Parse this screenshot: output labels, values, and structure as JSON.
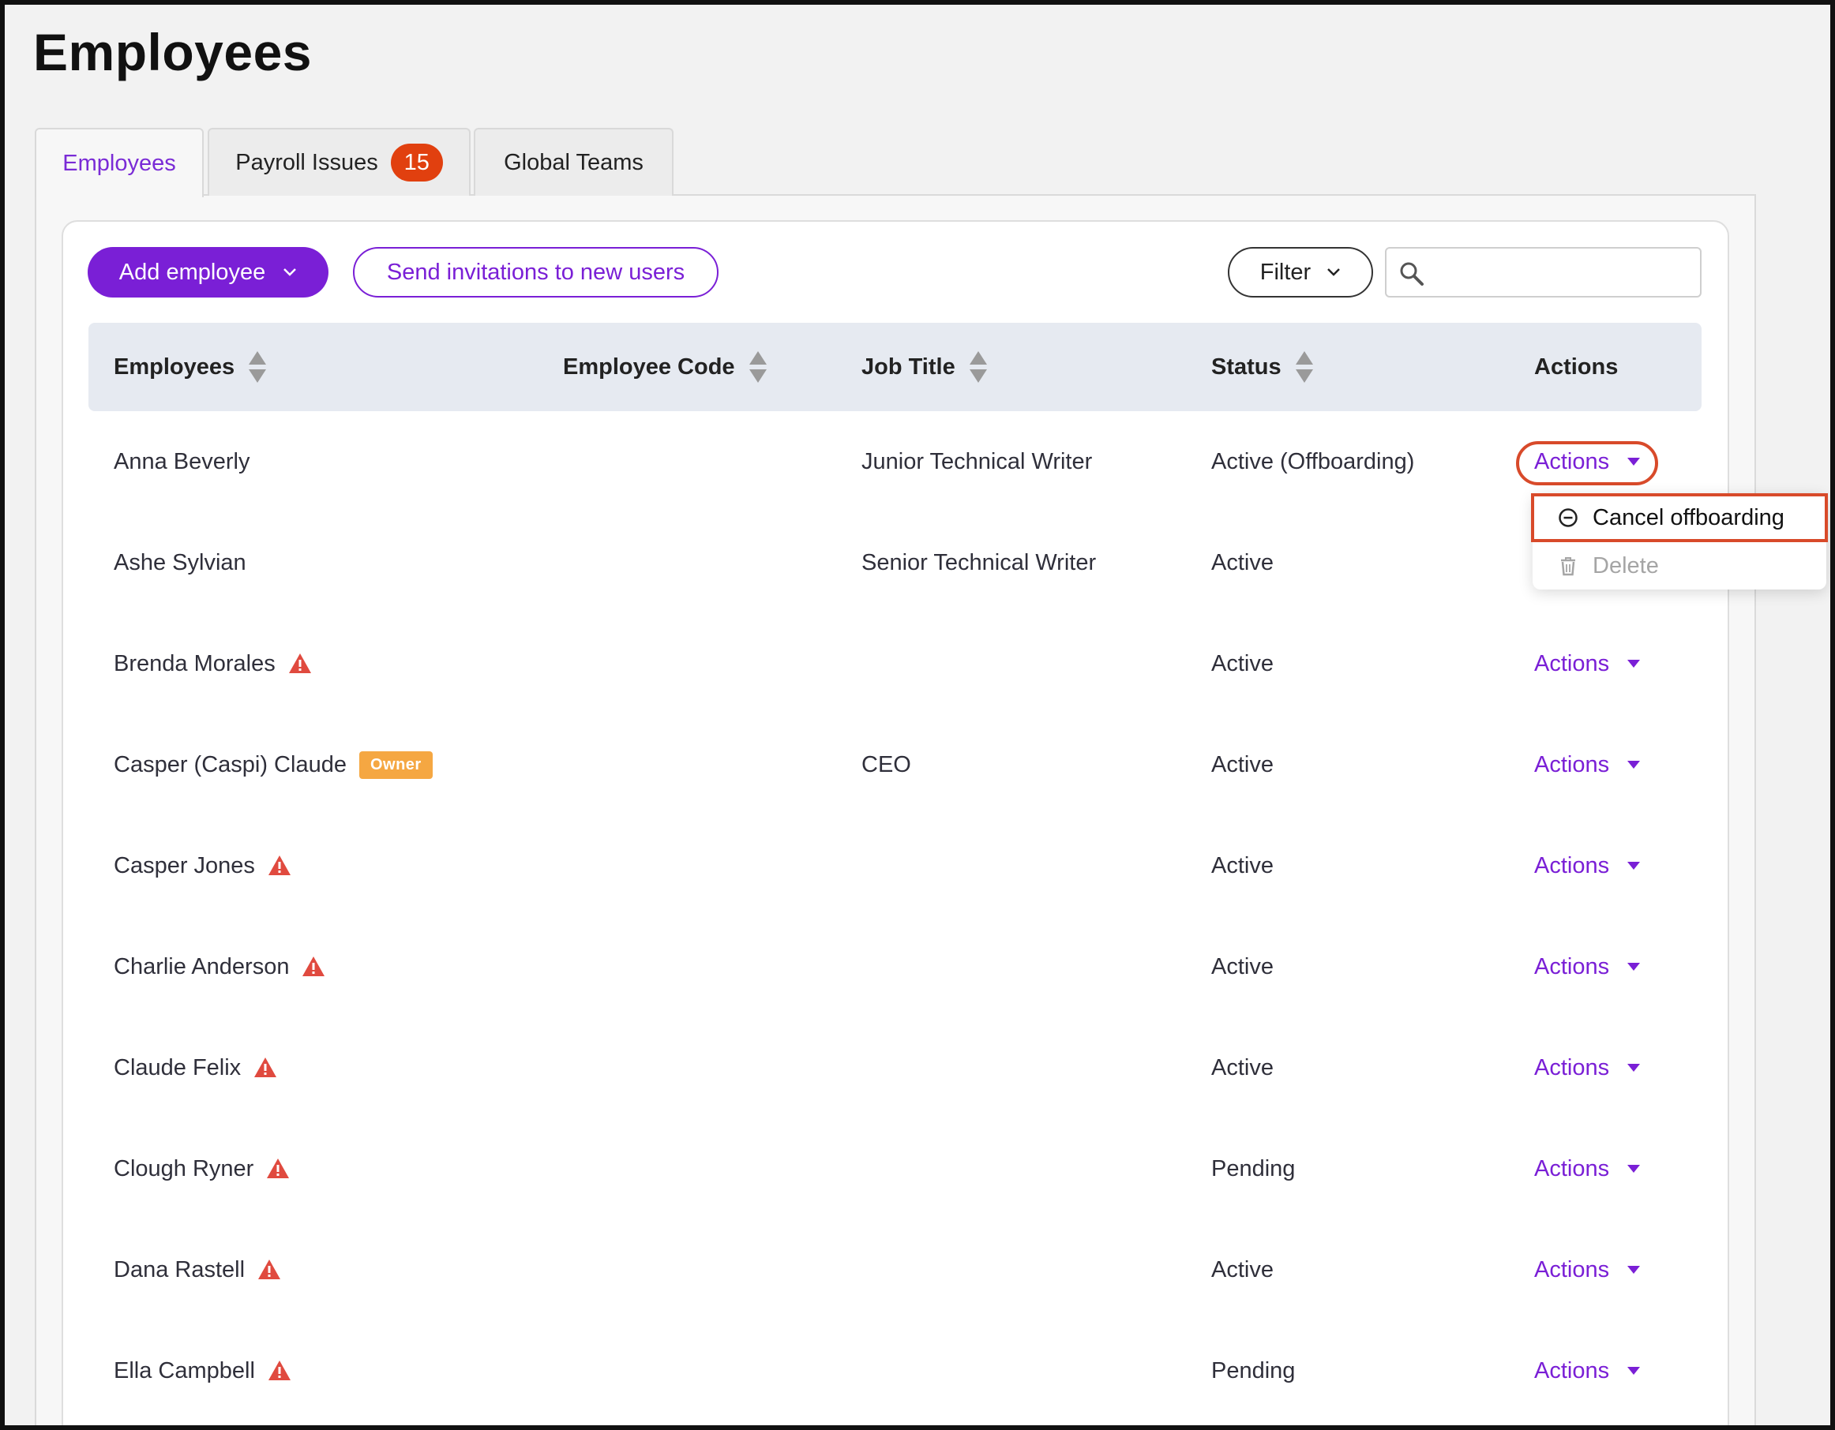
{
  "page": {
    "title": "Employees"
  },
  "tabs": [
    {
      "label": "Employees",
      "active": true
    },
    {
      "label": "Payroll Issues",
      "badge": "15",
      "active": false
    },
    {
      "label": "Global Teams",
      "active": false
    }
  ],
  "toolbar": {
    "add_employee": "Add employee",
    "send_invitations": "Send invitations to new users",
    "filter": "Filter",
    "search_placeholder": ""
  },
  "columns": {
    "employees": "Employees",
    "employee_code": "Employee Code",
    "job_title": "Job Title",
    "status": "Status",
    "actions": "Actions"
  },
  "rows": [
    {
      "name": "Anna Beverly",
      "job_title": "Junior Technical Writer",
      "status": "Active (Offboarding)",
      "actions": "Actions",
      "warning": false,
      "badge": ""
    },
    {
      "name": "Ashe Sylvian",
      "job_title": "Senior Technical Writer",
      "status": "Active",
      "actions": "",
      "warning": false,
      "badge": ""
    },
    {
      "name": "Brenda Morales",
      "job_title": "",
      "status": "Active",
      "actions": "Actions",
      "warning": true,
      "badge": ""
    },
    {
      "name": "Casper (Caspi) Claude",
      "job_title": "CEO",
      "status": "Active",
      "actions": "Actions",
      "warning": false,
      "badge": "Owner"
    },
    {
      "name": "Casper Jones",
      "job_title": "",
      "status": "Active",
      "actions": "Actions",
      "warning": true,
      "badge": ""
    },
    {
      "name": "Charlie Anderson",
      "job_title": "",
      "status": "Active",
      "actions": "Actions",
      "warning": true,
      "badge": ""
    },
    {
      "name": "Claude Felix",
      "job_title": "",
      "status": "Active",
      "actions": "Actions",
      "warning": true,
      "badge": ""
    },
    {
      "name": "Clough Ryner",
      "job_title": "",
      "status": "Pending",
      "actions": "Actions",
      "warning": true,
      "badge": ""
    },
    {
      "name": "Dana Rastell",
      "job_title": "",
      "status": "Active",
      "actions": "Actions",
      "warning": true,
      "badge": ""
    },
    {
      "name": "Ella Campbell",
      "job_title": "",
      "status": "Pending",
      "actions": "Actions",
      "warning": true,
      "badge": ""
    }
  ],
  "dropdown": {
    "cancel_offboarding": "Cancel offboarding",
    "delete": "Delete"
  },
  "colors": {
    "accent": "#7a1fd6",
    "warning": "#e04a3f",
    "badge_orange": "#f5a742",
    "highlight": "#d84a2a"
  }
}
